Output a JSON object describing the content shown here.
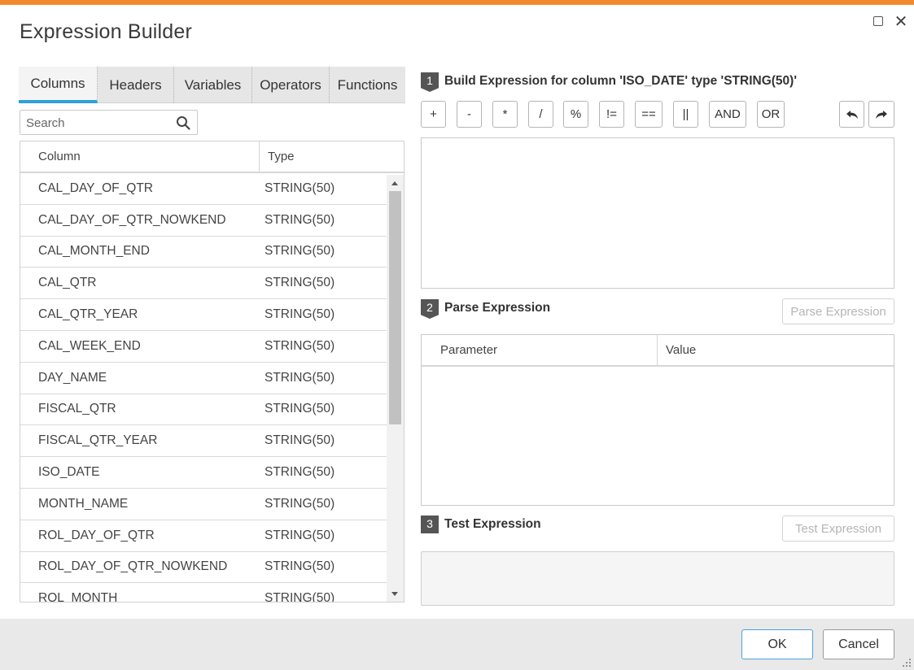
{
  "dialog": {
    "title": "Expression Builder",
    "accent_color": "#f28a2b"
  },
  "left_panel": {
    "tabs": [
      {
        "label": "Columns",
        "active": true
      },
      {
        "label": "Headers",
        "active": false
      },
      {
        "label": "Variables",
        "active": false
      },
      {
        "label": "Operators",
        "active": false
      },
      {
        "label": "Functions",
        "active": false
      }
    ],
    "search": {
      "placeholder": "Search",
      "icon": "search-icon"
    },
    "grid": {
      "headers": {
        "column": "Column",
        "type": "Type"
      },
      "rows": [
        {
          "column": "CAL_DAY_OF_QTR",
          "type": "STRING(50)"
        },
        {
          "column": "CAL_DAY_OF_QTR_NOWKEND",
          "type": "STRING(50)"
        },
        {
          "column": "CAL_MONTH_END",
          "type": "STRING(50)"
        },
        {
          "column": "CAL_QTR",
          "type": "STRING(50)"
        },
        {
          "column": "CAL_QTR_YEAR",
          "type": "STRING(50)"
        },
        {
          "column": "CAL_WEEK_END",
          "type": "STRING(50)"
        },
        {
          "column": "DAY_NAME",
          "type": "STRING(50)"
        },
        {
          "column": "FISCAL_QTR",
          "type": "STRING(50)"
        },
        {
          "column": "FISCAL_QTR_YEAR",
          "type": "STRING(50)"
        },
        {
          "column": "ISO_DATE",
          "type": "STRING(50)"
        },
        {
          "column": "MONTH_NAME",
          "type": "STRING(50)"
        },
        {
          "column": "ROL_DAY_OF_QTR",
          "type": "STRING(50)"
        },
        {
          "column": "ROL_DAY_OF_QTR_NOWKEND",
          "type": "STRING(50)"
        },
        {
          "column": "ROL_MONTH",
          "type": "STRING(50)"
        }
      ]
    }
  },
  "right_panel": {
    "step1": {
      "number": "1",
      "label": "Build Expression for column 'ISO_DATE' type 'STRING(50)'"
    },
    "operators": [
      "+",
      "-",
      "*",
      "/",
      "%",
      "!=",
      "==",
      "||",
      "AND",
      "OR"
    ],
    "undo_icon": "undo-icon",
    "redo_icon": "redo-icon",
    "expression_value": "",
    "step2": {
      "number": "2",
      "label": "Parse Expression",
      "button": "Parse Expression"
    },
    "param_grid": {
      "headers": {
        "parameter": "Parameter",
        "value": "Value"
      }
    },
    "step3": {
      "number": "3",
      "label": "Test Expression",
      "button": "Test Expression"
    }
  },
  "footer": {
    "ok_label": "OK",
    "cancel_label": "Cancel"
  }
}
